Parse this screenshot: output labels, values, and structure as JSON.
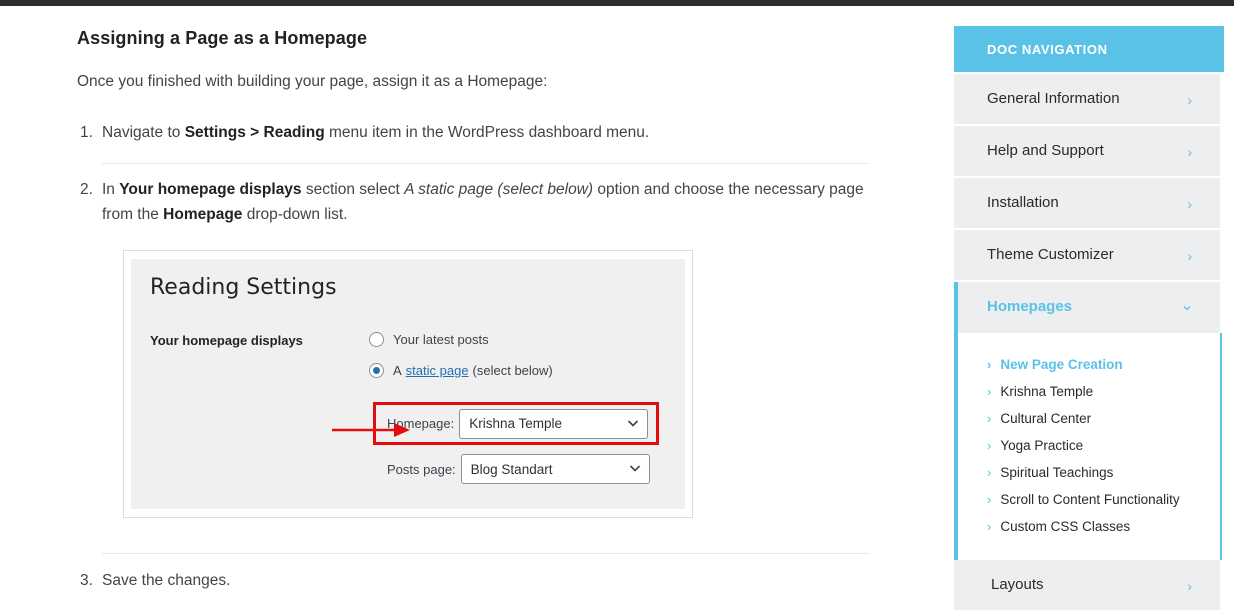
{
  "main": {
    "title": "Assigning a Page as a Homepage",
    "intro": "Once you finished with building your page, assign it as a Homepage:",
    "steps": [
      {
        "num": "1.",
        "pre": "Navigate to ",
        "bold1": "Settings > Reading",
        "post": " menu item in the WordPress dashboard menu."
      },
      {
        "num": "2.",
        "pre": "In ",
        "bold1": "Your homepage displays",
        "mid": " section select ",
        "italic": "A static page (select below)",
        "mid2": " option and choose the necessary page from the ",
        "bold2": "Homepage",
        "post": " drop-down list."
      },
      {
        "num": "3.",
        "text": "Save the changes."
      }
    ]
  },
  "figure": {
    "title": "Reading Settings",
    "label": "Your homepage displays",
    "radio_latest": "Your latest posts",
    "radio_static_pre": "A",
    "radio_static_link": "static page",
    "radio_static_post": "(select below)",
    "homepage_label": "Homepage:",
    "homepage_value": "Krishna Temple",
    "posts_label": "Posts page:",
    "posts_value": "Blog Standart",
    "highlight_color": "#e40c0c"
  },
  "sidebar": {
    "header": "DOC NAVIGATION",
    "items": [
      "General Information",
      "Help and Support",
      "Installation",
      "Theme Customizer",
      "Homepages",
      "Layouts"
    ],
    "sub_items": [
      "New Page Creation",
      "Krishna Temple",
      "Cultural Center",
      "Yoga Practice",
      "Spiritual Teachings",
      "Scroll to Content Functionality",
      "Custom CSS Classes"
    ],
    "accent_color": "#5bc2e7"
  }
}
